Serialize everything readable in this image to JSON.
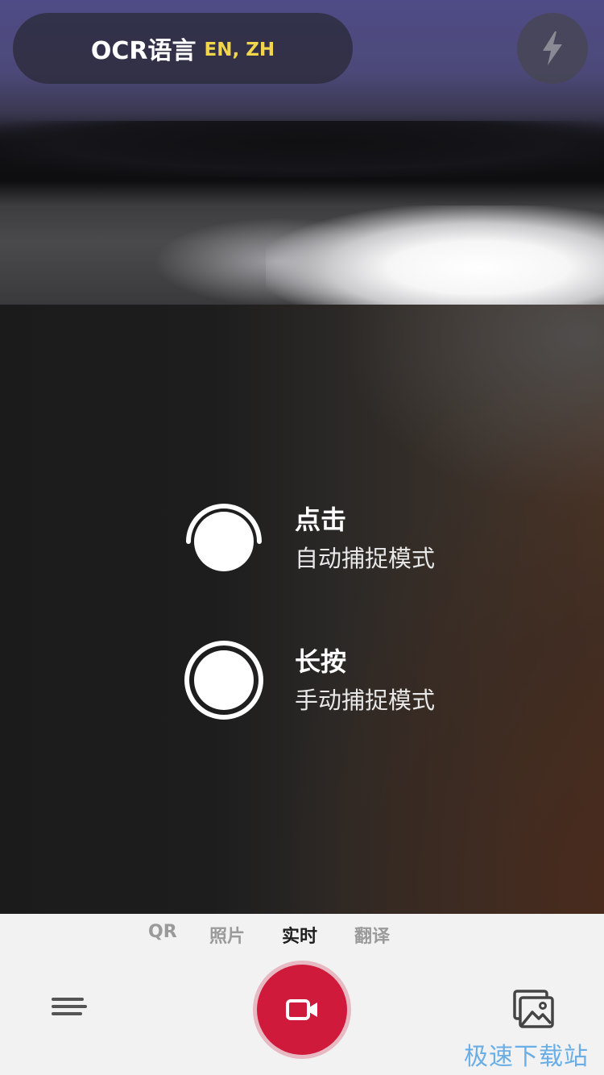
{
  "top_bar": {
    "ocr_language_label": "OCR语言",
    "ocr_language_codes": "EN, ZH",
    "flash_icon": "lightning-bolt-icon"
  },
  "instructions": {
    "tap": {
      "title": "点击",
      "subtitle": "自动捕捉模式",
      "icon": "tap-shutter-icon"
    },
    "hold": {
      "title": "长按",
      "subtitle": "手动捕捉模式",
      "icon": "hold-shutter-icon"
    }
  },
  "mode_tabs": [
    {
      "label": "QR",
      "selected": false
    },
    {
      "label": "照片",
      "selected": false
    },
    {
      "label": "实时",
      "selected": true
    },
    {
      "label": "翻译",
      "selected": false
    }
  ],
  "bottom_controls": {
    "menu_icon": "hamburger-menu-icon",
    "capture_icon": "video-camera-icon",
    "gallery_icon": "image-gallery-icon"
  },
  "colors": {
    "accent": "#cf1a3c",
    "language_codes": "#f1d54a",
    "watermark": "#69aee6"
  },
  "watermark": "极速下载站"
}
